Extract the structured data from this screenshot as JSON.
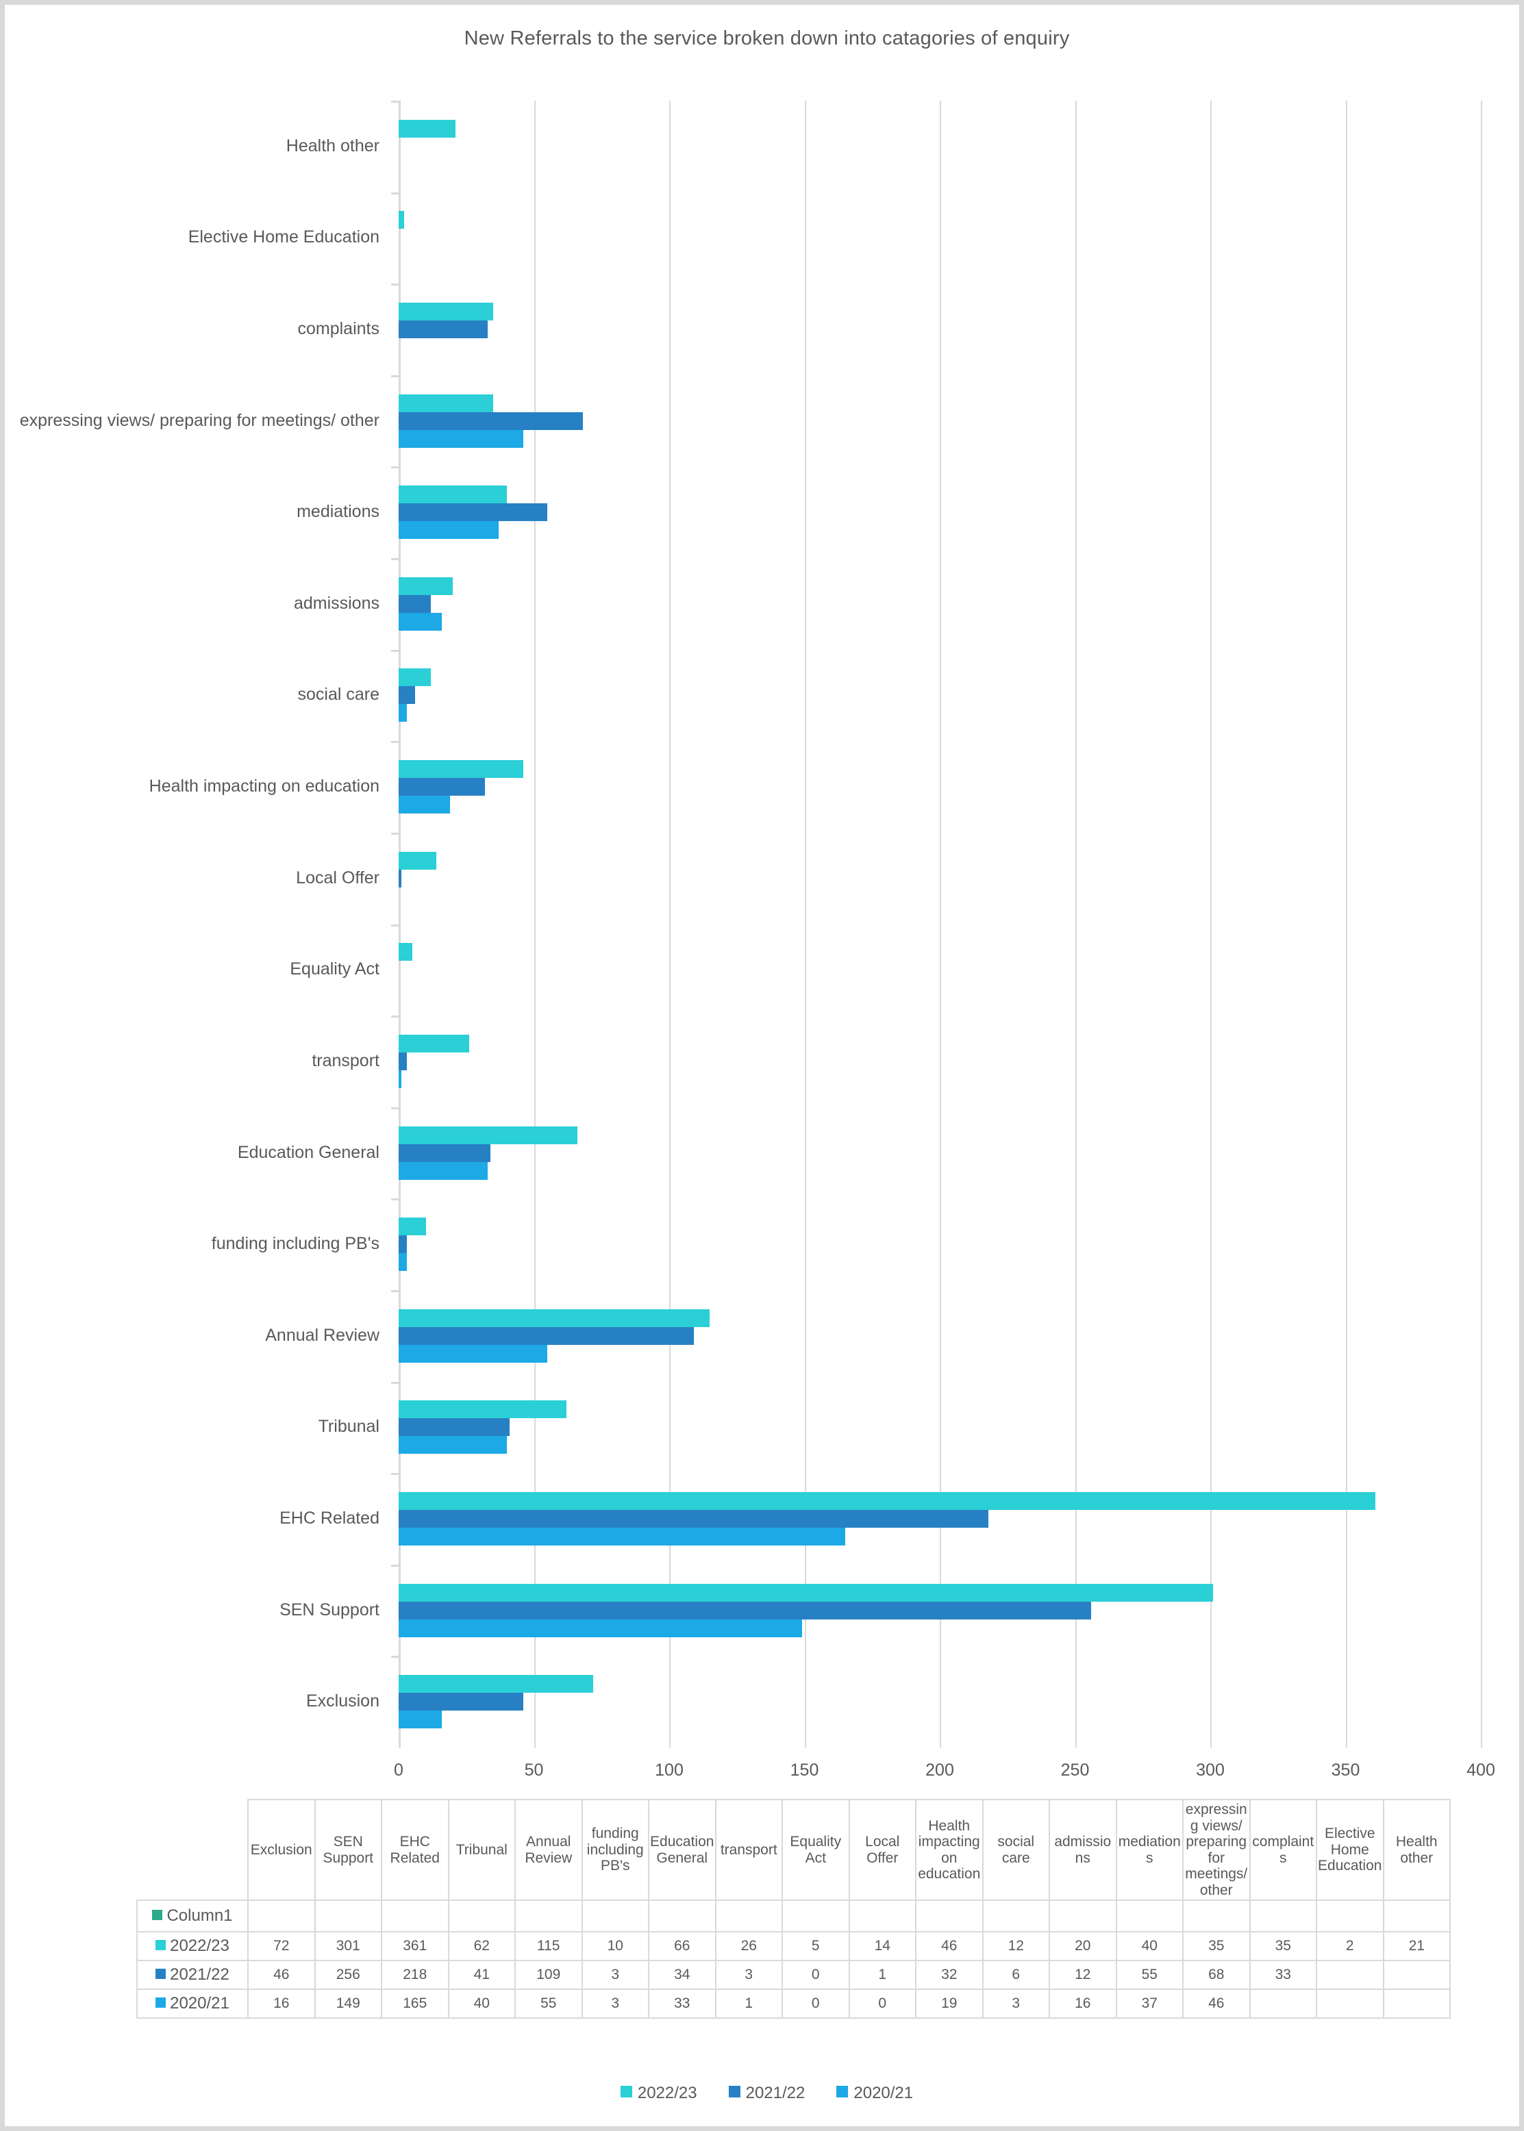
{
  "chart_title": "New Referrals to the service broken down into catagories of enquiry",
  "chart_data": {
    "type": "bar",
    "orientation": "horizontal",
    "title": "New Referrals to the service broken down into catagories of enquiry",
    "xlabel": "",
    "ylabel": "",
    "xlim": [
      0,
      400
    ],
    "xticks": [
      0,
      50,
      100,
      150,
      200,
      250,
      300,
      350,
      400
    ],
    "grid": "vertical",
    "legend_position": "bottom",
    "categories": [
      "Exclusion",
      "SEN Support",
      "EHC Related",
      "Tribunal",
      "Annual Review",
      "funding including PB's",
      "Education General",
      "transport",
      "Equality Act",
      "Local Offer",
      "Health impacting on education",
      "social care",
      "admissions",
      "mediations",
      "expressing views/ preparing for meetings/ other",
      "complaints",
      "Elective Home Education",
      "Health other"
    ],
    "series": [
      {
        "name": "2022/23",
        "color": "#2BCFD6",
        "values": [
          72,
          301,
          361,
          62,
          115,
          10,
          66,
          26,
          5,
          14,
          46,
          12,
          20,
          40,
          35,
          35,
          2,
          21
        ]
      },
      {
        "name": "2021/22",
        "color": "#2780C4",
        "values": [
          46,
          256,
          218,
          41,
          109,
          3,
          34,
          3,
          0,
          1,
          32,
          6,
          12,
          55,
          68,
          33,
          null,
          null
        ]
      },
      {
        "name": "2020/21",
        "color": "#1CA9E6",
        "values": [
          16,
          149,
          165,
          40,
          55,
          3,
          33,
          1,
          0,
          0,
          19,
          3,
          16,
          37,
          46,
          null,
          null,
          null
        ]
      }
    ]
  },
  "table": {
    "column_headers": [
      "Exclusion",
      "SEN Support",
      "EHC Related",
      "Tribunal",
      "Annual Review",
      "funding including PB's",
      "Education General",
      "transport",
      "Equality Act",
      "Local Offer",
      "Health impacting on education",
      "social care",
      "admissions",
      "mediations",
      "expressing views/ preparing for meetings/ other",
      "complaints",
      "Elective Home Education",
      "Health other"
    ],
    "rows": [
      {
        "label": "Column1",
        "swatch": "#2BA98A",
        "values": [
          "",
          "",
          "",
          "",
          "",
          "",
          "",
          "",
          "",
          "",
          "",
          "",
          "",
          "",
          "",
          "",
          "",
          ""
        ]
      },
      {
        "label": "2022/23",
        "swatch": "#2BCFD6",
        "values": [
          "72",
          "301",
          "361",
          "62",
          "115",
          "10",
          "66",
          "26",
          "5",
          "14",
          "46",
          "12",
          "20",
          "40",
          "35",
          "35",
          "2",
          "21"
        ]
      },
      {
        "label": "2021/22",
        "swatch": "#2780C4",
        "values": [
          "46",
          "256",
          "218",
          "41",
          "109",
          "3",
          "34",
          "3",
          "0",
          "1",
          "32",
          "6",
          "12",
          "55",
          "68",
          "33",
          "",
          ""
        ]
      },
      {
        "label": "2020/21",
        "swatch": "#1CA9E6",
        "values": [
          "16",
          "149",
          "165",
          "40",
          "55",
          "3",
          "33",
          "1",
          "0",
          "0",
          "19",
          "3",
          "16",
          "37",
          "46",
          "",
          "",
          ""
        ]
      }
    ]
  },
  "legend": {
    "items": [
      {
        "label": "2022/23",
        "color": "#2BCFD6"
      },
      {
        "label": "2021/22",
        "color": "#2780C4"
      },
      {
        "label": "2020/21",
        "color": "#1CA9E6"
      }
    ]
  }
}
